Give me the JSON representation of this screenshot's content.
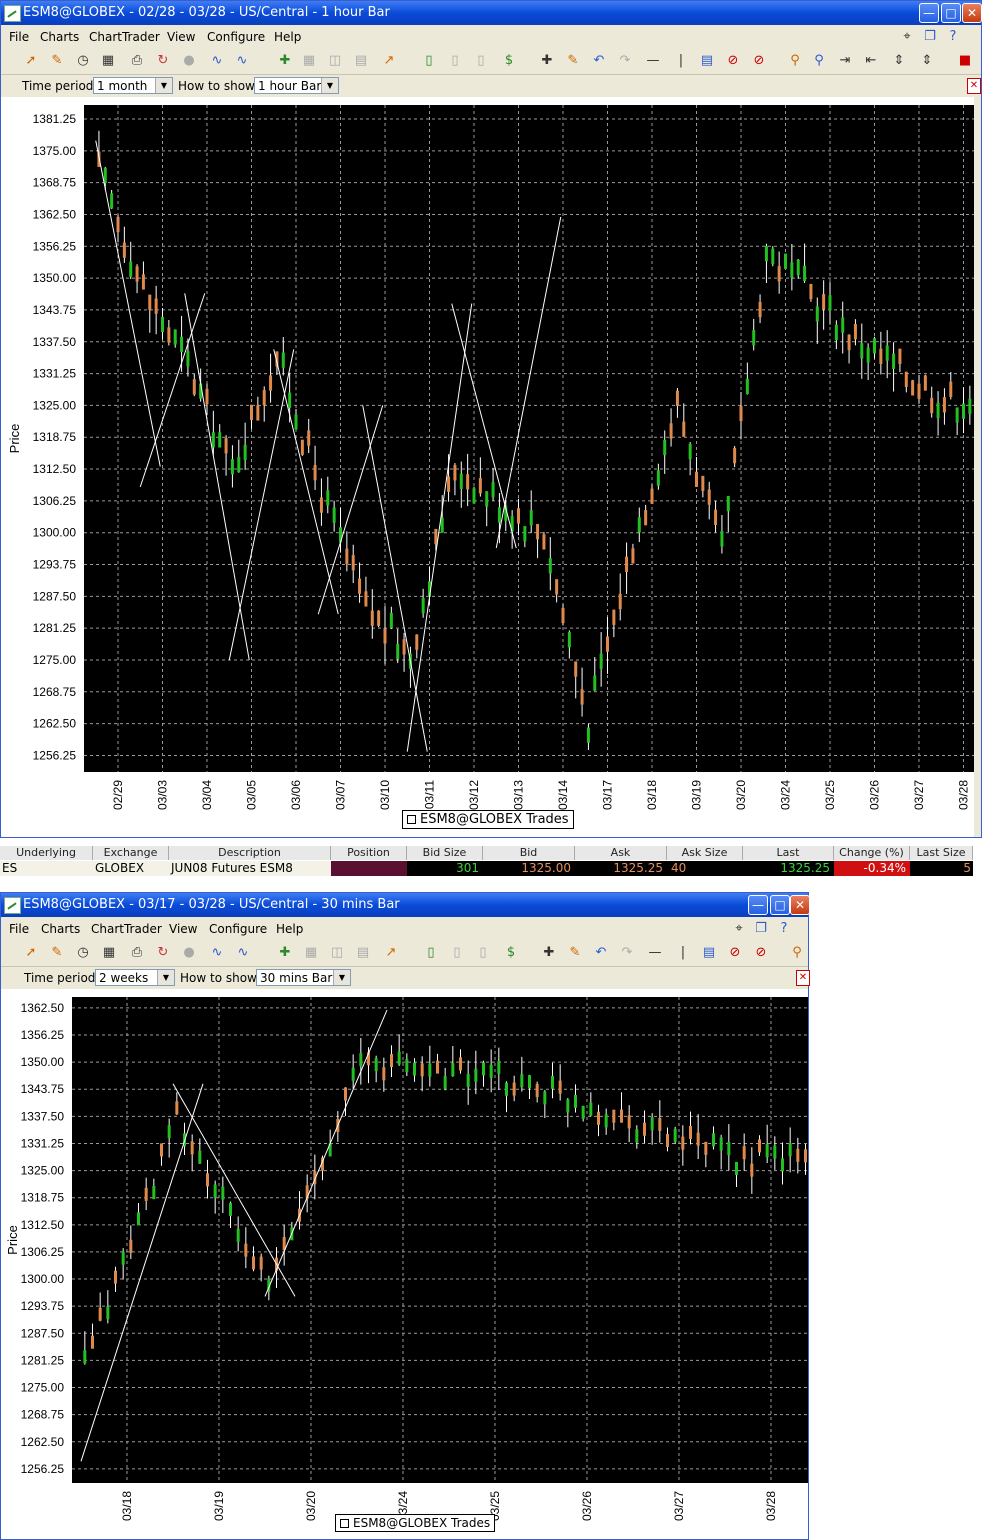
{
  "window1": {
    "title": "ESM8@GLOBEX - 02/28 - 03/28  - US/Central - 1 hour Bar",
    "menu": [
      "File",
      "Charts",
      "ChartTrader",
      "View",
      "Configure",
      "Help"
    ],
    "time_period_label": "Time period",
    "time_period_value": "1 month",
    "how_to_show_label": "How to show",
    "how_to_show_value": "1 hour Bar",
    "legend": "ESM8@GLOBEX Trades"
  },
  "market": {
    "headers": [
      "Underlying",
      "Exchange",
      "Description",
      "Position",
      "Bid Size",
      "Bid",
      "Ask",
      "Ask Size",
      "Last",
      "Change (%)",
      "Last Size"
    ],
    "row": {
      "underlying": "ES",
      "exchange": "GLOBEX",
      "description": "JUN08 Futures ESM8",
      "position": "",
      "bid_size": "301",
      "bid": "1325.00",
      "ask": "1325.25",
      "ask_size": "40",
      "last": "1325.25",
      "change": "-0.34%",
      "last_size": "5"
    }
  },
  "window2": {
    "title": "ESM8@GLOBEX - 03/17 - 03/28  - US/Central - 30 mins Bar",
    "menu": [
      "File",
      "Charts",
      "ChartTrader",
      "View",
      "Configure",
      "Help"
    ],
    "time_period_label": "Time period",
    "time_period_value": "2 weeks",
    "how_to_show_label": "How to show",
    "how_to_show_value": "30 mins Bar",
    "legend": "ESM8@GLOBEX Trades"
  },
  "colors": {
    "up": "#22c020",
    "down": "#e0894a",
    "background": "#000000",
    "grid": "#9a9a9a",
    "annot": "#ffffff"
  },
  "chart_data": [
    {
      "type": "bar",
      "title": "",
      "ylabel": "Price",
      "ylim": [
        1253,
        1384
      ],
      "yticks": [
        "1381.25",
        "1375.00",
        "1368.75",
        "1362.50",
        "1356.25",
        "1350.00",
        "1343.75",
        "1337.50",
        "1331.25",
        "1325.00",
        "1318.75",
        "1312.50",
        "1306.25",
        "1300.00",
        "1293.75",
        "1287.50",
        "1281.25",
        "1275.00",
        "1268.75",
        "1262.50",
        "1256.25"
      ],
      "x": [
        "02/29",
        "03/03",
        "03/04",
        "03/05",
        "03/06",
        "03/07",
        "03/10",
        "03/11",
        "03/12",
        "03/13",
        "03/14",
        "03/17",
        "03/18",
        "03/19",
        "03/20",
        "03/24",
        "03/25",
        "03/26",
        "03/27",
        "03/28"
      ],
      "series": [
        {
          "values": [
            1371,
            1348,
            1333,
            1312,
            1335,
            1308,
            1285,
            1276,
            1313,
            1306,
            1300,
            1263,
            1298,
            1325,
            1296,
            1355,
            1347,
            1338,
            1332,
            1326
          ]
        }
      ],
      "trendlines": [
        [
          1377,
          1313
        ],
        [
          1309,
          1347
        ],
        [
          1347,
          1275
        ],
        [
          1275,
          1336
        ],
        [
          1336,
          1284
        ],
        [
          1284,
          1325
        ],
        [
          1325,
          1257
        ],
        [
          1257,
          1345
        ],
        [
          1345,
          1297
        ],
        [
          1297,
          1362
        ]
      ]
    },
    {
      "type": "bar",
      "title": "",
      "ylabel": "Price",
      "ylim": [
        1253,
        1365
      ],
      "yticks": [
        "1362.50",
        "1356.25",
        "1350.00",
        "1343.75",
        "1337.50",
        "1331.25",
        "1325.00",
        "1318.75",
        "1312.50",
        "1306.25",
        "1300.00",
        "1293.75",
        "1287.50",
        "1281.25",
        "1275.00",
        "1268.75",
        "1262.50",
        "1256.25"
      ],
      "x": [
        "03/18",
        "03/19",
        "03/20",
        "03/24",
        "03/25",
        "03/26",
        "03/27",
        "03/28"
      ],
      "series": [
        {
          "values": [
            1280,
            1337,
            1298,
            1350,
            1348,
            1344,
            1336,
            1328
          ]
        }
      ],
      "trendlines": [
        [
          1258,
          1345
        ],
        [
          1345,
          1296
        ],
        [
          1296,
          1362
        ]
      ]
    }
  ]
}
